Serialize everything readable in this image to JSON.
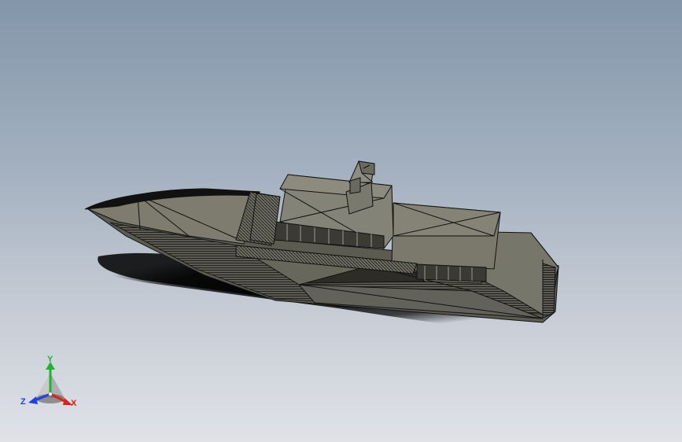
{
  "viewport": {
    "model": "yacht-3d-model"
  },
  "triad": {
    "x_label": "X",
    "y_label": "Y",
    "z_label": "Z",
    "x_color": "#e0201a",
    "y_color": "#1fb52a",
    "z_color": "#2040e0"
  }
}
